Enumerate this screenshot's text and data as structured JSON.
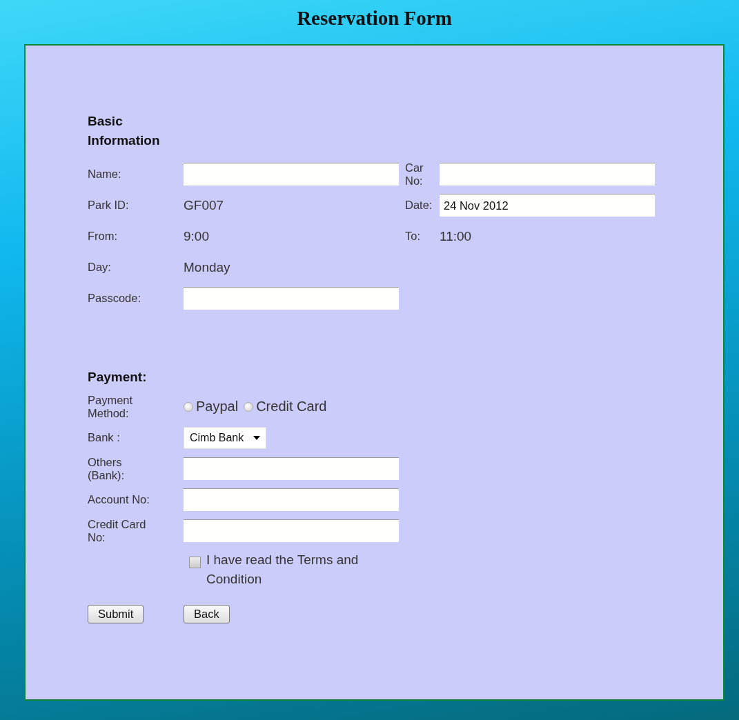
{
  "title": "Reservation Form",
  "basic": {
    "heading": "Basic Information",
    "rows": [
      {
        "left": {
          "label": "Name:",
          "kind": "input"
        },
        "right": {
          "label": "Car No:",
          "kind": "input"
        }
      },
      {
        "left": {
          "label": "Park ID:",
          "kind": "text",
          "value": "GF007"
        },
        "right": {
          "label": "Date:",
          "kind": "input",
          "value": "24 Nov 2012"
        }
      },
      {
        "left": {
          "label": "From:",
          "kind": "text",
          "value": "9:00"
        },
        "right": {
          "label": "To:",
          "kind": "text",
          "value": "11:00"
        }
      },
      {
        "left": {
          "label": "Day:",
          "kind": "text",
          "value": "Monday"
        }
      },
      {
        "left": {
          "label": "Passcode:",
          "kind": "input"
        }
      }
    ]
  },
  "payment": {
    "heading": "Payment:",
    "method": {
      "label": "Payment Method:",
      "options": [
        {
          "label": "Paypal",
          "selected": false
        },
        {
          "label": "Credit Card",
          "selected": false
        }
      ]
    },
    "bank": {
      "label": "Bank :",
      "value": "Cimb Bank"
    },
    "fields": [
      {
        "label": "Others (Bank):"
      },
      {
        "label": "Account No:"
      },
      {
        "label": "Credit Card No:"
      }
    ],
    "terms": {
      "label": "I have read the Terms and Condition",
      "checked": false
    },
    "buttons": [
      "Submit",
      "Back"
    ]
  }
}
